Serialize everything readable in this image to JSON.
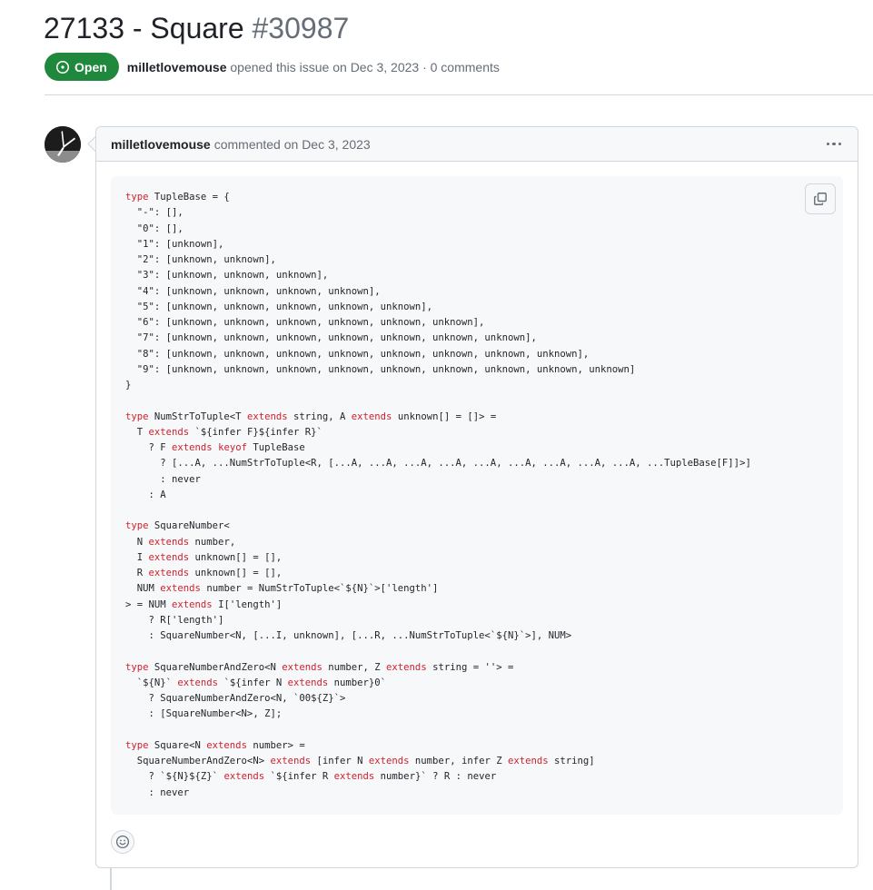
{
  "issue": {
    "title": "27133 - Square",
    "number": "#30987",
    "state": "Open",
    "author": "milletlovemouse",
    "opened_text": "opened this issue on Dec 3, 2023 · 0 comments"
  },
  "comment": {
    "author": "milletlovemouse",
    "meta": "commented on Dec 3, 2023",
    "code_lines": [
      "type TupleBase = {",
      "  \"-\": [],",
      "  \"0\": [],",
      "  \"1\": [unknown],",
      "  \"2\": [unknown, unknown],",
      "  \"3\": [unknown, unknown, unknown],",
      "  \"4\": [unknown, unknown, unknown, unknown],",
      "  \"5\": [unknown, unknown, unknown, unknown, unknown],",
      "  \"6\": [unknown, unknown, unknown, unknown, unknown, unknown],",
      "  \"7\": [unknown, unknown, unknown, unknown, unknown, unknown, unknown],",
      "  \"8\": [unknown, unknown, unknown, unknown, unknown, unknown, unknown, unknown],",
      "  \"9\": [unknown, unknown, unknown, unknown, unknown, unknown, unknown, unknown, unknown]",
      "}",
      "",
      "type NumStrToTuple<T extends string, A extends unknown[] = []> =",
      "  T extends `${infer F}${infer R}`",
      "    ? F extends keyof TupleBase",
      "      ? [...A, ...NumStrToTuple<R, [...A, ...A, ...A, ...A, ...A, ...A, ...A, ...A, ...A, ...TupleBase[F]]>]",
      "      : never",
      "    : A",
      "",
      "type SquareNumber<",
      "  N extends number,",
      "  I extends unknown[] = [],",
      "  R extends unknown[] = [],",
      "  NUM extends number = NumStrToTuple<`${N}`>['length']",
      "> = NUM extends I['length']",
      "    ? R['length']",
      "    : SquareNumber<N, [...I, unknown], [...R, ...NumStrToTuple<`${N}`>], NUM>",
      "",
      "type SquareNumberAndZero<N extends number, Z extends string = ''> =",
      "  `${N}` extends `${infer N extends number}0`",
      "    ? SquareNumberAndZero<N, `00${Z}`>",
      "    : [SquareNumber<N>, Z];",
      "",
      "type Square<N extends number> =",
      "  SquareNumberAndZero<N> extends [infer N extends number, infer Z extends string]",
      "    ? `${N}${Z}` extends `${infer R extends number}` ? R : never",
      "    : never"
    ],
    "keywords": [
      "type",
      "extends",
      "keyof"
    ]
  },
  "colors": {
    "open_badge": "#1f883d",
    "keyword": "#cf222e",
    "muted_text": "#656d76",
    "border": "#d0d7de"
  },
  "icons": {
    "state": "issue-opened-icon",
    "menu": "kebab-horizontal-icon",
    "copy": "copy-icon",
    "reaction": "smiley-icon"
  }
}
